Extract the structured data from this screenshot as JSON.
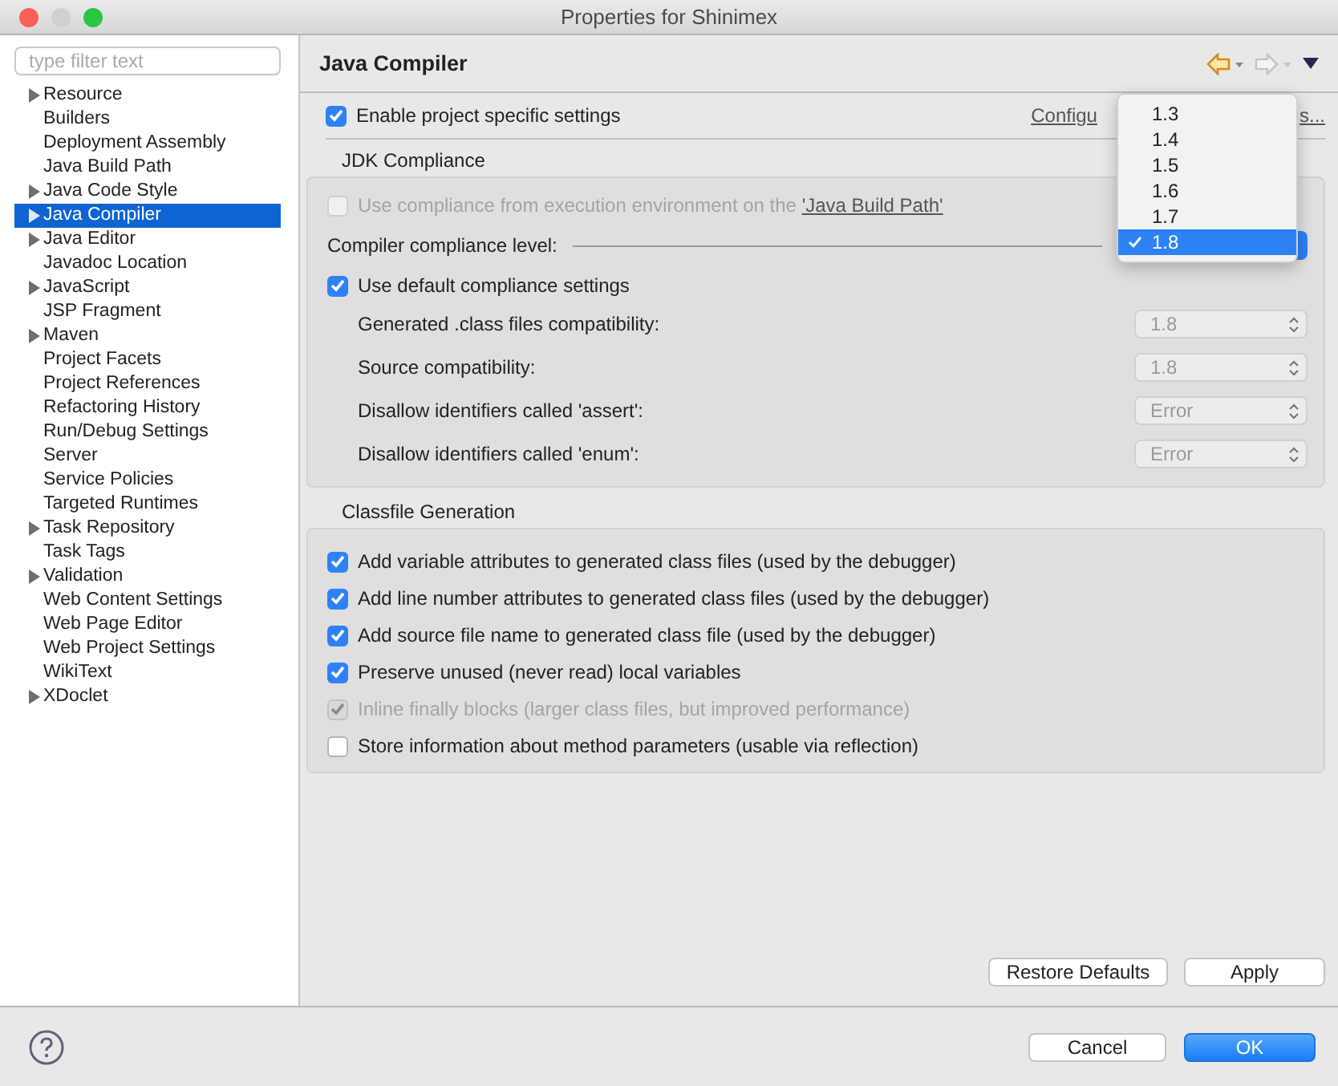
{
  "window": {
    "title": "Properties for Shinimex"
  },
  "sidebar": {
    "filter": {
      "placeholder": "type filter text"
    },
    "items": [
      {
        "label": "Resource",
        "expandable": true,
        "selected": false
      },
      {
        "label": "Builders",
        "expandable": false,
        "selected": false
      },
      {
        "label": "Deployment Assembly",
        "expandable": false,
        "selected": false
      },
      {
        "label": "Java Build Path",
        "expandable": false,
        "selected": false
      },
      {
        "label": "Java Code Style",
        "expandable": true,
        "selected": false
      },
      {
        "label": "Java Compiler",
        "expandable": true,
        "selected": true
      },
      {
        "label": "Java Editor",
        "expandable": true,
        "selected": false
      },
      {
        "label": "Javadoc Location",
        "expandable": false,
        "selected": false
      },
      {
        "label": "JavaScript",
        "expandable": true,
        "selected": false
      },
      {
        "label": "JSP Fragment",
        "expandable": false,
        "selected": false
      },
      {
        "label": "Maven",
        "expandable": true,
        "selected": false
      },
      {
        "label": "Project Facets",
        "expandable": false,
        "selected": false
      },
      {
        "label": "Project References",
        "expandable": false,
        "selected": false
      },
      {
        "label": "Refactoring History",
        "expandable": false,
        "selected": false
      },
      {
        "label": "Run/Debug Settings",
        "expandable": false,
        "selected": false
      },
      {
        "label": "Server",
        "expandable": false,
        "selected": false
      },
      {
        "label": "Service Policies",
        "expandable": false,
        "selected": false
      },
      {
        "label": "Targeted Runtimes",
        "expandable": false,
        "selected": false
      },
      {
        "label": "Task Repository",
        "expandable": true,
        "selected": false
      },
      {
        "label": "Task Tags",
        "expandable": false,
        "selected": false
      },
      {
        "label": "Validation",
        "expandable": true,
        "selected": false
      },
      {
        "label": "Web Content Settings",
        "expandable": false,
        "selected": false
      },
      {
        "label": "Web Page Editor",
        "expandable": false,
        "selected": false
      },
      {
        "label": "Web Project Settings",
        "expandable": false,
        "selected": false
      },
      {
        "label": "WikiText",
        "expandable": false,
        "selected": false
      },
      {
        "label": "XDoclet",
        "expandable": true,
        "selected": false
      }
    ]
  },
  "page": {
    "title": "Java Compiler",
    "nav_buttons": [
      {
        "kind": "back",
        "disabled": false
      },
      {
        "kind": "forward",
        "disabled": true
      },
      {
        "kind": "menu",
        "disabled": false
      }
    ]
  },
  "enable_specific": {
    "label": "Enable project specific settings",
    "checked": true
  },
  "configure_link": {
    "visible_start": "Configu",
    "visible_end": "s..."
  },
  "jdk_compliance": {
    "title": "JDK Compliance",
    "use_execution_environment": {
      "label": "Use compliance from execution environment on the ",
      "link": "'Java Build Path'",
      "checked": false,
      "disabled": true
    },
    "compliance_level": {
      "label": "Compiler compliance level:"
    },
    "use_default": {
      "label": "Use default compliance settings",
      "checked": true
    },
    "settings": [
      {
        "label": "Generated .class files compatibility:",
        "value": "1.8",
        "disabled": true
      },
      {
        "label": "Source compatibility:",
        "value": "1.8",
        "disabled": true
      },
      {
        "label": "Disallow identifiers called 'assert':",
        "value": "Error",
        "disabled": true
      },
      {
        "label": "Disallow identifiers called 'enum':",
        "value": "Error",
        "disabled": true
      }
    ]
  },
  "compliance_menu": {
    "options": [
      {
        "label": "1.3",
        "selected": false
      },
      {
        "label": "1.4",
        "selected": false
      },
      {
        "label": "1.5",
        "selected": false
      },
      {
        "label": "1.6",
        "selected": false
      },
      {
        "label": "1.7",
        "selected": false
      },
      {
        "label": "1.8",
        "selected": true
      }
    ]
  },
  "classfile": {
    "title": "Classfile Generation",
    "options": [
      {
        "label": "Add variable attributes to generated class files (used by the debugger)",
        "checked": true,
        "disabled": false
      },
      {
        "label": "Add line number attributes to generated class files (used by the debugger)",
        "checked": true,
        "disabled": false
      },
      {
        "label": "Add source file name to generated class file (used by the debugger)",
        "checked": true,
        "disabled": false
      },
      {
        "label": "Preserve unused (never read) local variables",
        "checked": true,
        "disabled": false
      },
      {
        "label": "Inline finally blocks (larger class files, but improved performance)",
        "checked": true,
        "disabled": true
      },
      {
        "label": "Store information about method parameters (usable via reflection)",
        "checked": false,
        "disabled": false
      }
    ]
  },
  "page_buttons": [
    {
      "label": "Restore Defaults"
    },
    {
      "label": "Apply"
    }
  ],
  "footer_buttons": [
    {
      "label": "Cancel",
      "kind": "normal"
    },
    {
      "label": "OK",
      "kind": "default"
    }
  ]
}
